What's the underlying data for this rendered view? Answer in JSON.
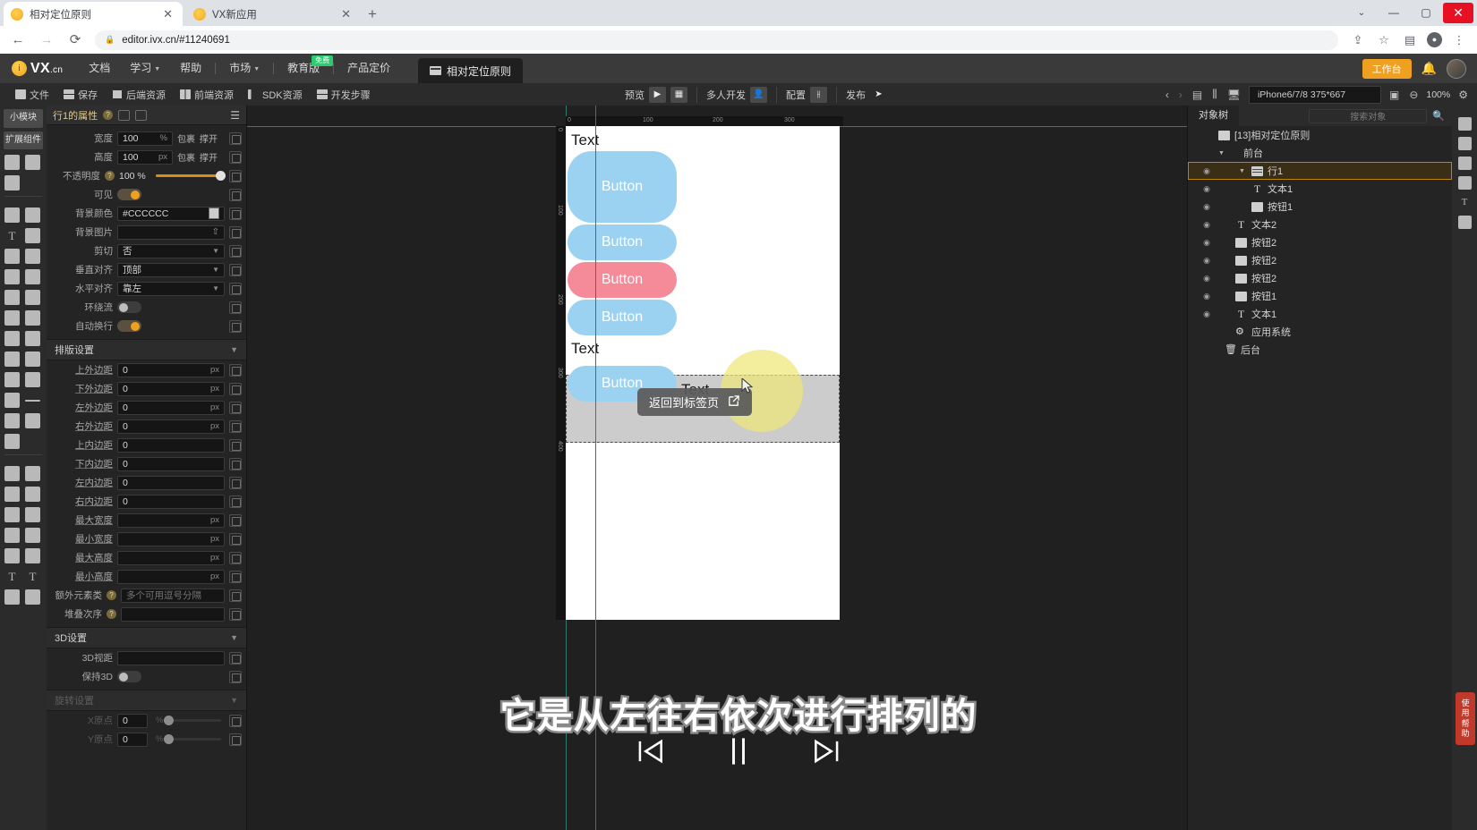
{
  "browser": {
    "tabs": [
      {
        "title": "相对定位原则",
        "active": true,
        "favicon": "ivx-favicon",
        "close": "✕"
      },
      {
        "title": "VX新应用",
        "active": false,
        "favicon": "ivx-favicon",
        "close": "✕"
      }
    ],
    "new_tab": "+",
    "window_controls": {
      "chevron": "⌄",
      "minimize": "—",
      "maximize": "▢",
      "close": "✕"
    },
    "nav": {
      "back": "←",
      "forward": "→",
      "reload": "⟳"
    },
    "url": "editor.ivx.cn/#11240691",
    "lock_icon": "🔒",
    "omni_right": {
      "share": "⇪",
      "star": "☆",
      "sidepanel": "▤",
      "profile": "●",
      "menu": "⋮"
    }
  },
  "appnav": {
    "brand": "VX",
    "brand_suffix": ".cn",
    "items": [
      {
        "label": "文档",
        "caret": false
      },
      {
        "label": "学习",
        "caret": true
      },
      {
        "label": "帮助",
        "caret": false
      },
      {
        "label": "市场",
        "caret": true
      },
      {
        "label": "教育版",
        "caret": false,
        "badge": "免费"
      },
      {
        "label": "产品定价",
        "caret": false
      }
    ],
    "project_tab": "相对定位原则",
    "workbench": "工作台",
    "bell": "🔔"
  },
  "filebar": {
    "items": [
      {
        "label": "文件",
        "icon": "folder-icon"
      },
      {
        "label": "保存",
        "icon": "save-icon"
      },
      {
        "label": "后端资源",
        "icon": "backend-icon"
      },
      {
        "label": "前端资源",
        "icon": "frontend-icon"
      },
      {
        "label": "SDK资源",
        "icon": "sdk-icon"
      },
      {
        "label": "开发步骤",
        "icon": "steps-icon"
      }
    ]
  },
  "center_toolbar": {
    "preview_label": "预览",
    "play_icon": "▶",
    "qr_icon": "▦",
    "collab_label": "多人开发",
    "collab_icon": "👤",
    "config_label": "配置",
    "config_icon": "⫲",
    "publish_label": "发布",
    "publish_icon": "➤"
  },
  "right_toolbar": {
    "prev": "‹",
    "next": "›",
    "align_icon": "▤",
    "distribute_icon": "⫼",
    "device_icon": "🖥",
    "device": "iPhone6/7/8 375*667",
    "screenshot_icon": "▣",
    "minus": "⊖",
    "zoom": "100%",
    "settings_icon": "⚙"
  },
  "rail": {
    "tab_modules": "小模块",
    "tab_extensions": "扩展组件"
  },
  "properties": {
    "title": "行1的属性",
    "help": "?",
    "menu_icon": "☰",
    "basic": [
      {
        "label": "宽度",
        "value": "100",
        "unit": "%",
        "suffix": [
          "包裹",
          "撑开"
        ]
      },
      {
        "label": "高度",
        "value": "100",
        "unit": "px",
        "suffix": [
          "包裹",
          "撑开"
        ]
      }
    ],
    "opacity": {
      "label": "不透明度",
      "help": "?",
      "value": "100 %"
    },
    "visible": {
      "label": "可见",
      "state": "on"
    },
    "bgcolor": {
      "label": "背景颜色",
      "value": "#CCCCCC",
      "swatch": "#CCCCCC"
    },
    "bgimage": {
      "label": "背景图片",
      "value": ""
    },
    "clip": {
      "label": "剪切",
      "value": "否"
    },
    "valign": {
      "label": "垂直对齐",
      "value": "顶部"
    },
    "halign": {
      "label": "水平对齐",
      "value": "靠左"
    },
    "ring": {
      "label": "环绕流",
      "state": "off"
    },
    "wrap": {
      "label": "自动换行",
      "state": "on"
    },
    "layout_section": "排版设置",
    "layout": [
      {
        "label": "上外边距",
        "value": "0",
        "unit": "px"
      },
      {
        "label": "下外边距",
        "value": "0",
        "unit": "px"
      },
      {
        "label": "左外边距",
        "value": "0",
        "unit": "px"
      },
      {
        "label": "右外边距",
        "value": "0",
        "unit": "px"
      },
      {
        "label": "上内边距",
        "value": "0",
        "unit": ""
      },
      {
        "label": "下内边距",
        "value": "0",
        "unit": ""
      },
      {
        "label": "左内边距",
        "value": "0",
        "unit": ""
      },
      {
        "label": "右内边距",
        "value": "0",
        "unit": ""
      },
      {
        "label": "最大宽度",
        "value": "",
        "unit": "px"
      },
      {
        "label": "最小宽度",
        "value": "",
        "unit": "px"
      },
      {
        "label": "最大高度",
        "value": "",
        "unit": "px"
      },
      {
        "label": "最小高度",
        "value": "",
        "unit": "px"
      }
    ],
    "extra_class": {
      "label": "额外元素类",
      "help": "?",
      "placeholder": "多个可用逗号分隔"
    },
    "zindex": {
      "label": "堆叠次序",
      "help": "?",
      "value": ""
    },
    "threed_section": "3D设置",
    "threed_dist": {
      "label": "3D视距",
      "value": ""
    },
    "keep3d": {
      "label": "保持3D",
      "state": "off"
    },
    "rotate_section": "旋转设置",
    "rotate_x": {
      "label": "X原点",
      "value": "0",
      "unit": "%"
    },
    "rotate_y": {
      "label": "Y原点",
      "value": "0",
      "unit": "%"
    }
  },
  "canvas": {
    "ruler_h": [
      "0",
      "100",
      "200",
      "300"
    ],
    "ruler_v": [
      "0",
      "100",
      "200",
      "300",
      "400"
    ],
    "elements": [
      {
        "type": "text",
        "label": "Text"
      },
      {
        "type": "button",
        "label": "Button",
        "color": "blue",
        "tall": true
      },
      {
        "type": "button",
        "label": "Button",
        "color": "blue"
      },
      {
        "type": "button",
        "label": "Button",
        "color": "pink"
      },
      {
        "type": "button",
        "label": "Button",
        "color": "blue"
      },
      {
        "type": "text",
        "label": "Text"
      },
      {
        "type": "button",
        "label": "Button",
        "color": "blue"
      },
      {
        "type": "text",
        "label": "Text"
      }
    ],
    "tooltip": "返回到标签页",
    "tooltip_icon": "↗",
    "cursor": "arrow-cursor"
  },
  "objtree": {
    "tab": "对象树",
    "search_placeholder": "搜索对象",
    "search_icon": "🔍",
    "nodes": [
      {
        "label": "[13]相对定位原则",
        "icon": "app-icon",
        "indent": 1,
        "eye": false,
        "tri": ""
      },
      {
        "label": "前台",
        "icon": "phone-icon",
        "indent": 2,
        "eye": false,
        "tri": "▼"
      },
      {
        "label": "行1",
        "icon": "row-icon",
        "indent": 3,
        "eye": true,
        "tri": "▼",
        "selected": true
      },
      {
        "label": "文本1",
        "icon": "text-icon",
        "indent": 5,
        "eye": true,
        "tri": ""
      },
      {
        "label": "按钮1",
        "icon": "button-icon",
        "indent": 5,
        "eye": true,
        "tri": ""
      },
      {
        "label": "文本2",
        "icon": "text-icon",
        "indent": 4,
        "eye": true,
        "tri": ""
      },
      {
        "label": "按钮2",
        "icon": "button-icon",
        "indent": 4,
        "eye": true,
        "tri": ""
      },
      {
        "label": "按钮2",
        "icon": "button-icon",
        "indent": 4,
        "eye": true,
        "tri": ""
      },
      {
        "label": "按钮2",
        "icon": "button-icon",
        "indent": 4,
        "eye": true,
        "tri": ""
      },
      {
        "label": "按钮1",
        "icon": "button-icon",
        "indent": 4,
        "eye": true,
        "tri": ""
      },
      {
        "label": "文本1",
        "icon": "text-icon",
        "indent": 4,
        "eye": true,
        "tri": ""
      },
      {
        "label": "应用系统",
        "icon": "gear-icon",
        "indent": 4,
        "eye": false,
        "tri": ""
      },
      {
        "label": "后台",
        "icon": "bucket-icon",
        "indent": 3,
        "eye": false,
        "tri": ""
      }
    ]
  },
  "help_button": "使用帮助",
  "video": {
    "caption": "它是从左往右依次进行排列的",
    "prev_icon": "⏮",
    "pause_icon": "⏸",
    "next_icon": "⏭"
  }
}
